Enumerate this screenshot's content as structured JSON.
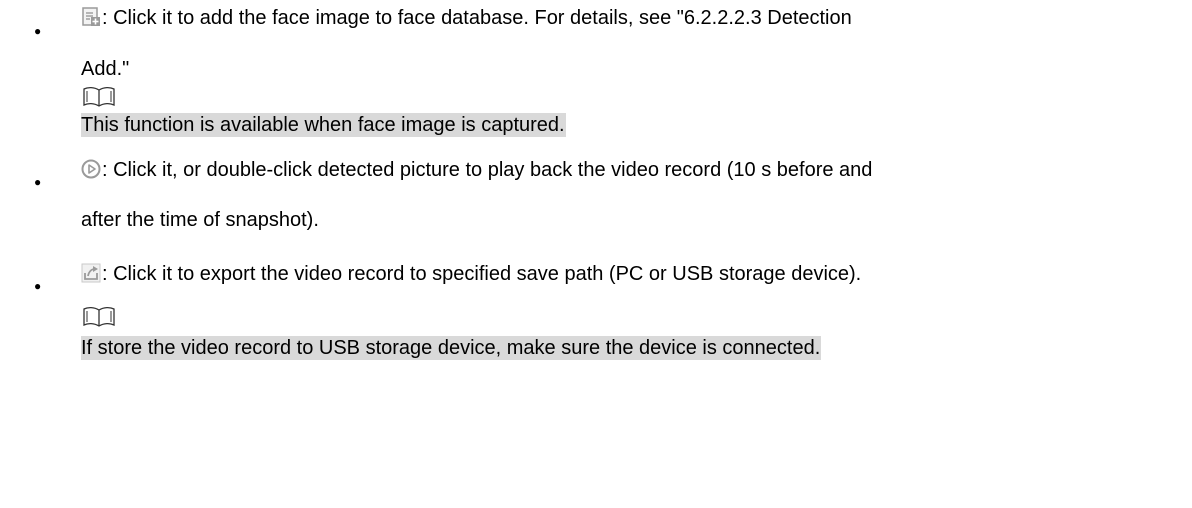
{
  "items": [
    {
      "icon": "add-to-database-icon",
      "lines": [
        ": Click it to add the face image to face database. For details, see \"6.2.2.2.3 Detection",
        "Add.\""
      ],
      "note_icon": "book-icon",
      "note": "This function is available when face image is captured."
    },
    {
      "icon": "play-icon",
      "lines": [
        ": Click it, or double-click detected picture to play back the video record (10 s before and",
        "after the time of snapshot)."
      ]
    },
    {
      "icon": "export-icon",
      "lines": [
        ": Click it to export the video record to specified save path (PC or USB storage device)."
      ],
      "note_icon": "book-icon",
      "note": "If store the video record to USB storage device, make sure the device is connected."
    }
  ],
  "colors": {
    "icon_gray": "#9a9a9a",
    "note_background": "#d9d9d9"
  }
}
